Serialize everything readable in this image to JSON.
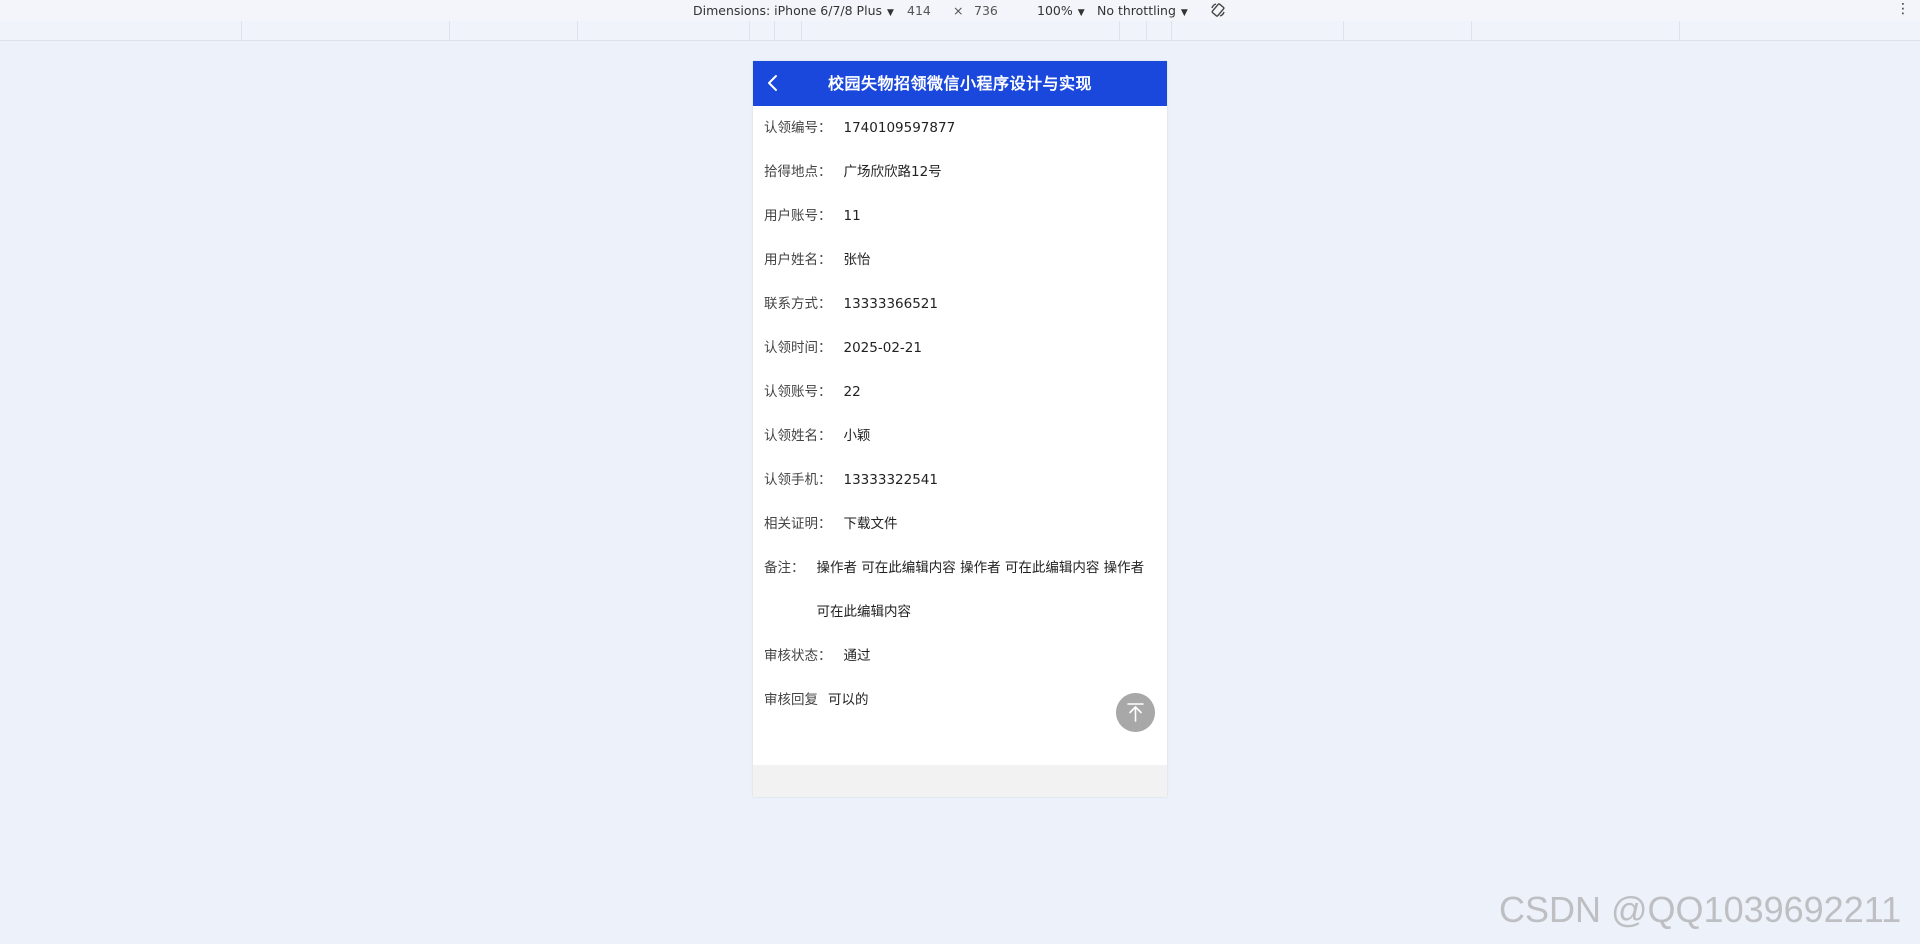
{
  "devtools": {
    "dimensions_label": "Dimensions: iPhone 6/7/8 Plus",
    "width": "414",
    "times": "×",
    "height": "736",
    "zoom": "100%",
    "throttling": "No throttling",
    "more_glyph": "⋮",
    "caret_glyph": "▼"
  },
  "header": {
    "title": "校园失物招领微信小程序设计与实现",
    "back_icon": "chevron-left-icon"
  },
  "details": [
    {
      "label": "认领编号：",
      "value": "1740109597877"
    },
    {
      "label": "拾得地点：",
      "value": "广场欣欣路12号"
    },
    {
      "label": "用户账号：",
      "value": "11"
    },
    {
      "label": "用户姓名：",
      "value": "张怡"
    },
    {
      "label": "联系方式：",
      "value": "13333366521"
    },
    {
      "label": "认领时间：",
      "value": "2025-02-21"
    },
    {
      "label": "认领账号：",
      "value": "22"
    },
    {
      "label": "认领姓名：",
      "value": "小颖"
    },
    {
      "label": "认领手机：",
      "value": "13333322541"
    }
  ],
  "proof": {
    "label": "相关证明：",
    "value": "下载文件"
  },
  "remark": {
    "label": "备注：",
    "value": "操作者 可在此编辑内容 操作者 可在此编辑内容 操作者 可在此编辑内容"
  },
  "audit_status": {
    "label": "审核状态：",
    "value": "通过"
  },
  "audit_reply": {
    "label": "审核回复",
    "value": "可以的"
  },
  "watermark": "CSDN @QQ1039692211",
  "colors": {
    "nav": "#1a48dc",
    "background": "#edf1f9",
    "back_top": "#a8a8a8"
  }
}
